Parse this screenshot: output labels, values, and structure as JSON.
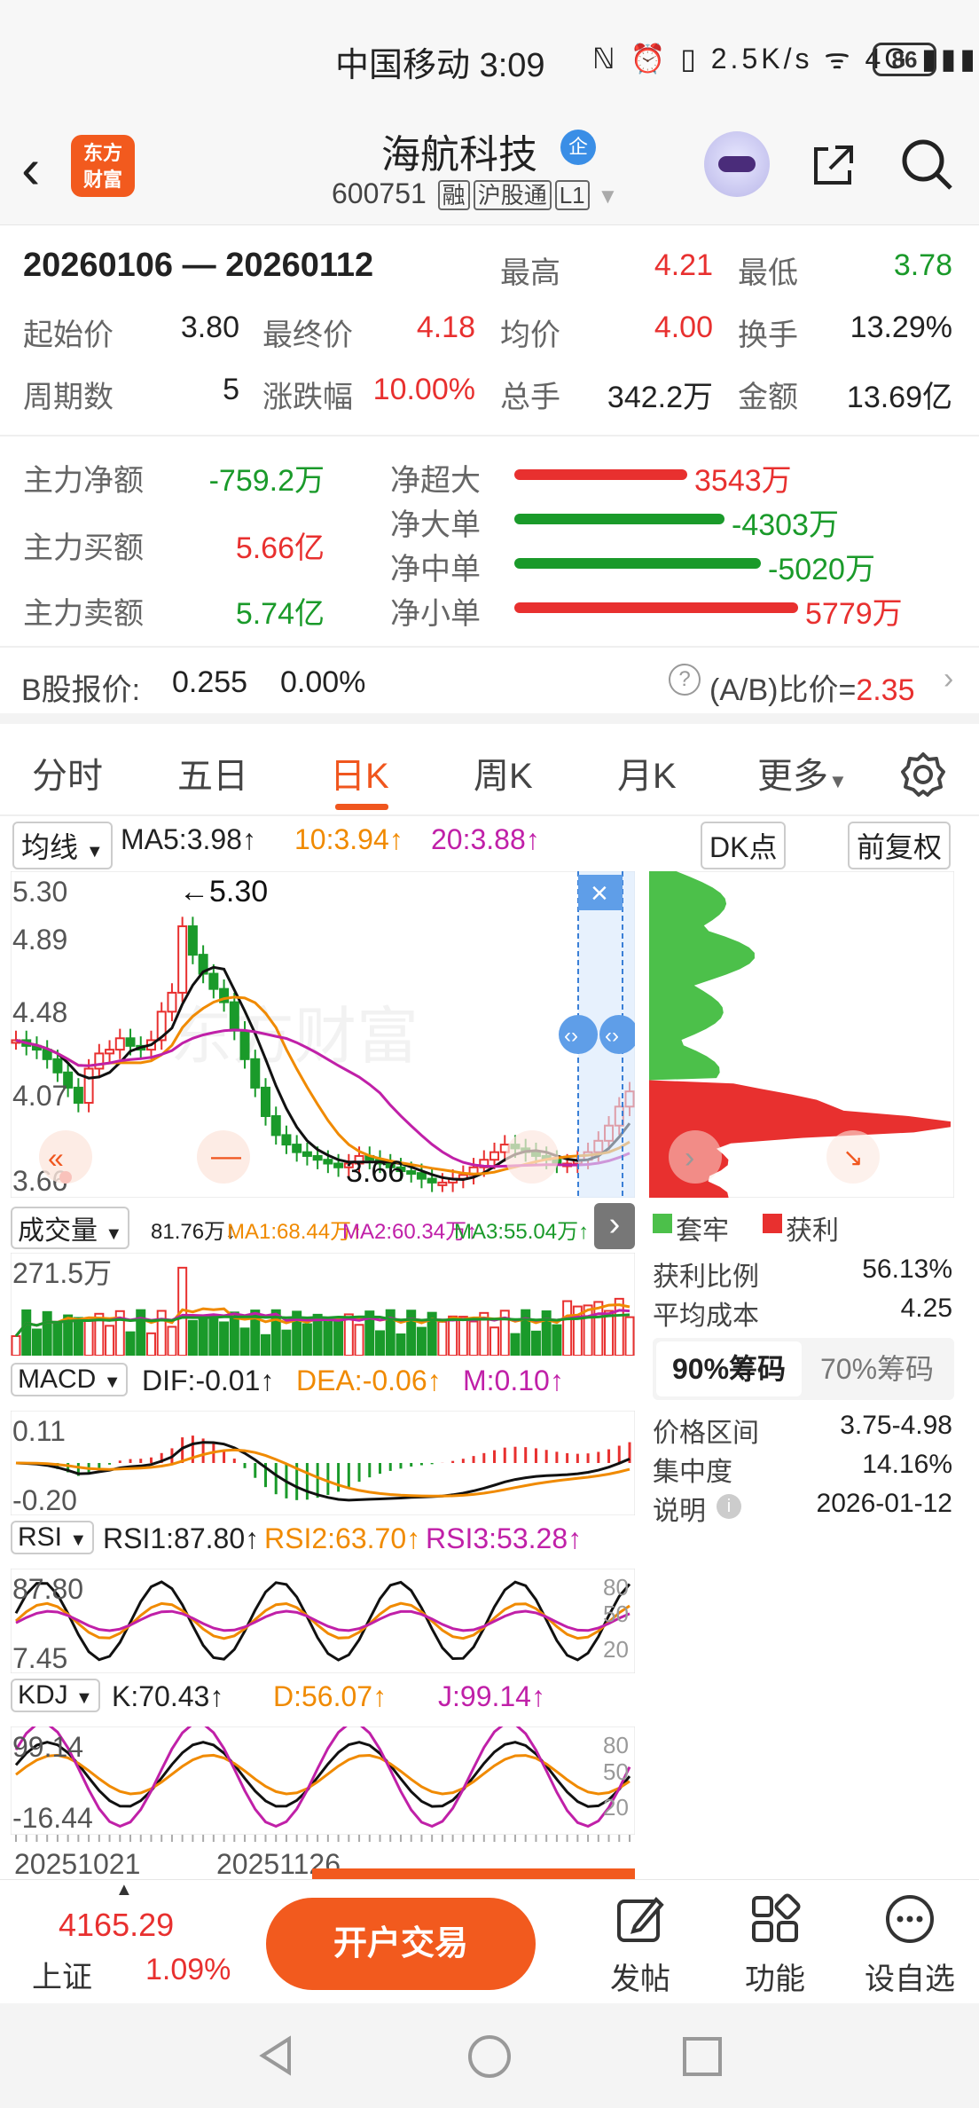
{
  "status": {
    "carrier": "中国移动",
    "time": "3:09",
    "icons": "ℕ ⏰ ▯ 2.5K/s ᯤ 4G ▮▮▮",
    "battery": "86"
  },
  "header": {
    "title": "海航科技",
    "qi_badge": "企",
    "code": "600751",
    "tags": [
      "融",
      "沪股通",
      "L1"
    ],
    "logo": "东方财富"
  },
  "range": {
    "start": "20260106",
    "dash": "—",
    "end": "20260112"
  },
  "stats": {
    "high_label": "最高",
    "high": "4.21",
    "low_label": "最低",
    "low": "3.78",
    "open_label": "起始价",
    "open": "3.80",
    "close_label": "最终价",
    "close": "4.18",
    "avg_label": "均价",
    "avg": "4.00",
    "turnover_label": "换手",
    "turnover": "13.29%",
    "periods_label": "周期数",
    "periods": "5",
    "change_label": "涨跌幅",
    "change": "10.00%",
    "volume_label": "总手",
    "volume": "342.2万",
    "amount_label": "金额",
    "amount": "13.69亿"
  },
  "flow": {
    "net_label": "主力净额",
    "net": "-759.2万",
    "buy_label": "主力买额",
    "buy": "5.66亿",
    "sell_label": "主力卖额",
    "sell": "5.74亿",
    "items": [
      {
        "label": "净超大",
        "value": "3543万",
        "color": "#e8302f",
        "fill": 0.61
      },
      {
        "label": "净大单",
        "value": "-4303万",
        "color": "#1a9a2a",
        "fill": 0.74
      },
      {
        "label": "净中单",
        "value": "-5020万",
        "color": "#1a9a2a",
        "fill": 0.87
      },
      {
        "label": "净小单",
        "value": "5779万",
        "color": "#e8302f",
        "fill": 1.0
      }
    ]
  },
  "bshare": {
    "label": "B股报价:",
    "price": "0.255",
    "pct": "0.00%",
    "ab_label": "(A/B)比价=",
    "ab_value": "2.35"
  },
  "tabs": [
    "分时",
    "五日",
    "日K",
    "周K",
    "月K",
    "更多"
  ],
  "chart": {
    "ma_chip": "均线",
    "ma5": "MA5:3.98↑",
    "ma10": "10:3.94↑",
    "ma20": "20:3.88↑",
    "dk_chip": "DK点",
    "adjust_chip": "前复权",
    "y_labels": [
      "5.30",
      "4.89",
      "4.48",
      "4.07",
      "3.66"
    ],
    "high_mark": "←5.30",
    "low_mark": "3.66",
    "watermark": "东方财富",
    "vol_chip": "成交量",
    "vol_text": "81.76万↓",
    "vol_ma1": "MA1:68.44万↑",
    "vol_ma2": "MA2:60.34万↑",
    "vol_ma3": "MA3:55.04万↑",
    "vol_y": "271.5万",
    "macd_chip": "MACD",
    "dif": "DIF:-0.01↑",
    "dea": "DEA:-0.06↑",
    "m": "M:0.10↑",
    "macd_y": [
      "0.11",
      "-0.20"
    ],
    "rsi_chip": "RSI",
    "rsi1": "RSI1:87.80↑",
    "rsi2": "RSI2:63.70↑",
    "rsi3": "RSI3:53.28↑",
    "rsi_y": [
      "87.80",
      "7.45"
    ],
    "rsi_r": [
      "80",
      "50",
      "20"
    ],
    "kdj_chip": "KDJ",
    "k": "K:70.43↑",
    "d": "D:56.07↑",
    "j": "J:99.14↑",
    "kdj_y": [
      "99.14",
      "-16.44"
    ],
    "kdj_r": [
      "80",
      "50",
      "20"
    ],
    "x_labels": [
      "20251021",
      "20251126"
    ],
    "sel_dates": "20260106 — 20260112"
  },
  "chips_panel": {
    "legend_trap": "套牢",
    "legend_profit": "获利",
    "profit_ratio_label": "获利比例",
    "profit_ratio": "56.13%",
    "avg_cost_label": "平均成本",
    "avg_cost": "4.25",
    "tab90": "90%筹码",
    "tab70": "70%筹码",
    "range_label": "价格区间",
    "range": "3.75-4.98",
    "conc_label": "集中度",
    "conc": "14.16%",
    "note_label": "说明",
    "note": "2026-01-12"
  },
  "bottom": {
    "index_value": "4165.29",
    "index_name": "上证",
    "index_pct": "1.09%",
    "trade": "开户交易",
    "post": "发帖",
    "func": "功能",
    "watch": "设自选"
  },
  "colors": {
    "up": "#e8302f",
    "down": "#1a9a2a",
    "accent": "#f0561e",
    "ma10": "#f08a00",
    "ma20": "#c020a8"
  }
}
